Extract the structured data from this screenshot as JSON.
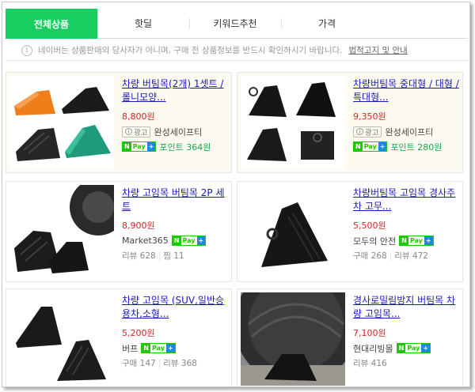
{
  "tabs": [
    "전체상품",
    "핫딜",
    "키워드추천",
    "가격"
  ],
  "notice": {
    "icon": "info-icon",
    "text": "네이버는 상품판매의 당사자가 아니며, 구매 전 상품정보를 반드시 확인하시기 바랍니다.",
    "link": "법적고지 및 안내"
  },
  "products": [
    {
      "title": "차량 버팀목(2개) 1셋트 / 롤니모양...",
      "price": "8,800원",
      "ad": "광고",
      "seller": "완성세이프티",
      "pay": "N Pay",
      "point": "포인트 364원"
    },
    {
      "title": "차량버팀목 중대형 / 대형 / 특대형...",
      "price": "9,350원",
      "ad": "광고",
      "seller": "완성세이프티",
      "pay": "N Pay",
      "point": "포인트 280원"
    },
    {
      "title": "차량 고임목 버팀목 2P 세트",
      "price": "8,900원",
      "seller": "Market365",
      "pay": "N Pay",
      "stats": [
        "리뷰 628",
        "찜 11"
      ]
    },
    {
      "title": "차량버팀목 고임목 경사주차 고무...",
      "price": "5,500원",
      "seller": "모두의 안전",
      "pay": "N Pay",
      "stats": [
        "구매 268",
        "리뷰 472"
      ]
    },
    {
      "title": "차량 고임목 (SUV,일반승용차,소형...",
      "price": "5,200원",
      "seller": "버프",
      "pay": "N Pay",
      "stats": [
        "구매 147",
        "리뷰 368"
      ]
    },
    {
      "title": "경사로밀림방지 버팀목 차량 고임목...",
      "price": "7,100원",
      "seller": "현대리빙몰",
      "pay": "N Pay",
      "stats": [
        "리뷰 416"
      ]
    }
  ]
}
